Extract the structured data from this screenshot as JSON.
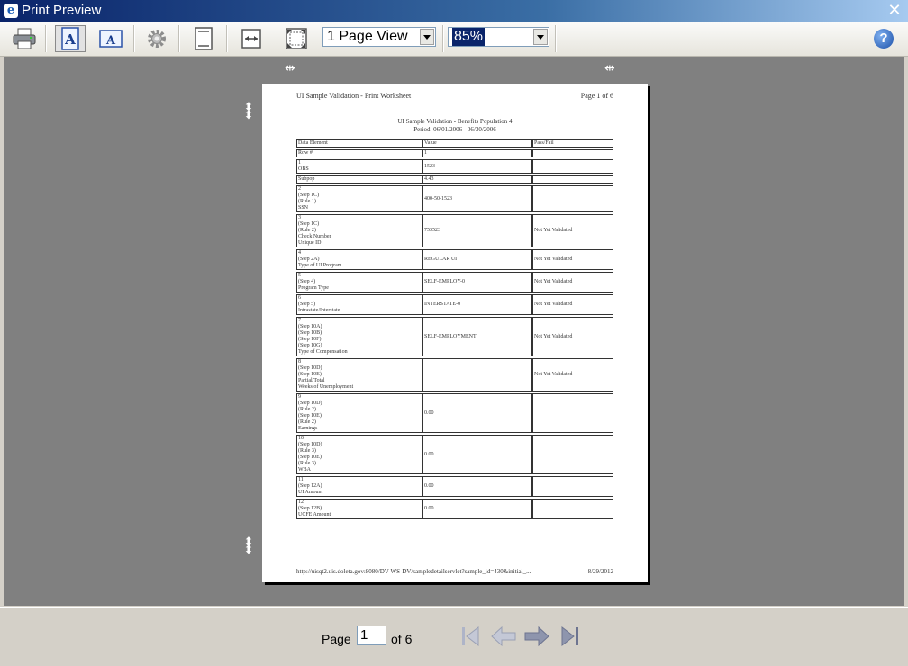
{
  "window": {
    "title": "Print Preview"
  },
  "toolbar": {
    "view_mode": "1 Page View",
    "zoom": "85%"
  },
  "page": {
    "header_left": "UI Sample Validation - Print Worksheet",
    "header_right": "Page 1 of 6",
    "title_line1": "UI Sample Validation - Benefits Population 4",
    "title_line2": "Period: 06/01/2006 - 06/30/2006",
    "table": {
      "headers": [
        "Data Element",
        "Value",
        "Pass/Fail"
      ],
      "rows": [
        {
          "label": [
            "Row #"
          ],
          "value": "1",
          "status": ""
        },
        {
          "label": [
            "1",
            "OBS"
          ],
          "value": "1523",
          "status": ""
        },
        {
          "label": [
            "Subpop"
          ],
          "value": "4.43",
          "status": ""
        },
        {
          "label": [
            "2",
            "(Step 1C)",
            "(Rule 1)",
            "SSN"
          ],
          "value": "400-50-1523",
          "status": ""
        },
        {
          "label": [
            "3",
            "(Step 1C)",
            "(Rule 2)",
            "Check Number",
            "Unique ID"
          ],
          "value": "753523",
          "status": "Not Yet Validated"
        },
        {
          "label": [
            "4",
            "(Step 2A)",
            "Type of UI Program"
          ],
          "value": "REGULAR UI",
          "status": "Not Yet Validated"
        },
        {
          "label": [
            "5",
            "(Step 4)",
            "Program Type"
          ],
          "value": "SELF-EMPLOY-0",
          "status": "Not Yet Validated"
        },
        {
          "label": [
            "6",
            "(Step 5)",
            "Intrastate/Interstate"
          ],
          "value": "INTERSTATE-0",
          "status": "Not Yet Validated"
        },
        {
          "label": [
            "7",
            "(Step 10A)",
            "(Step 10B)",
            "(Step 10F)",
            "(Step 10G)",
            "Type of Compensation"
          ],
          "value": "SELF-EMPLOYMENT",
          "status": "Not Yet Validated"
        },
        {
          "label": [
            "8",
            "(Step 10D)",
            "(Step 10E)",
            "Partial/Total",
            "Weeks of Unemployment"
          ],
          "value": "",
          "status": "Not Yet Validated"
        },
        {
          "label": [
            "9",
            "(Step 10D)",
            "(Rule 2)",
            "(Step 10E)",
            "(Rule 2)",
            "Earnings"
          ],
          "value": "0.00",
          "status": ""
        },
        {
          "label": [
            "10",
            "(Step 10D)",
            "(Rule 3)",
            "(Step 10E)",
            "(Rule 3)",
            "WBA"
          ],
          "value": "0.00",
          "status": ""
        },
        {
          "label": [
            "11",
            "(Step 12A)",
            "UI Amount"
          ],
          "value": "0.00",
          "status": ""
        },
        {
          "label": [
            "12",
            "(Step 12B)",
            "UCFE Amount"
          ],
          "value": "0.00",
          "status": ""
        }
      ]
    },
    "footer_url": "http://uisqt2.uis.doleta.gov:8080/DV-WS-DV/sampledetailservlet?sample_id=430&initial_...",
    "footer_date": "8/29/2012"
  },
  "navbar": {
    "page_label": "Page",
    "page_value": "1",
    "of_label": "of 6"
  }
}
